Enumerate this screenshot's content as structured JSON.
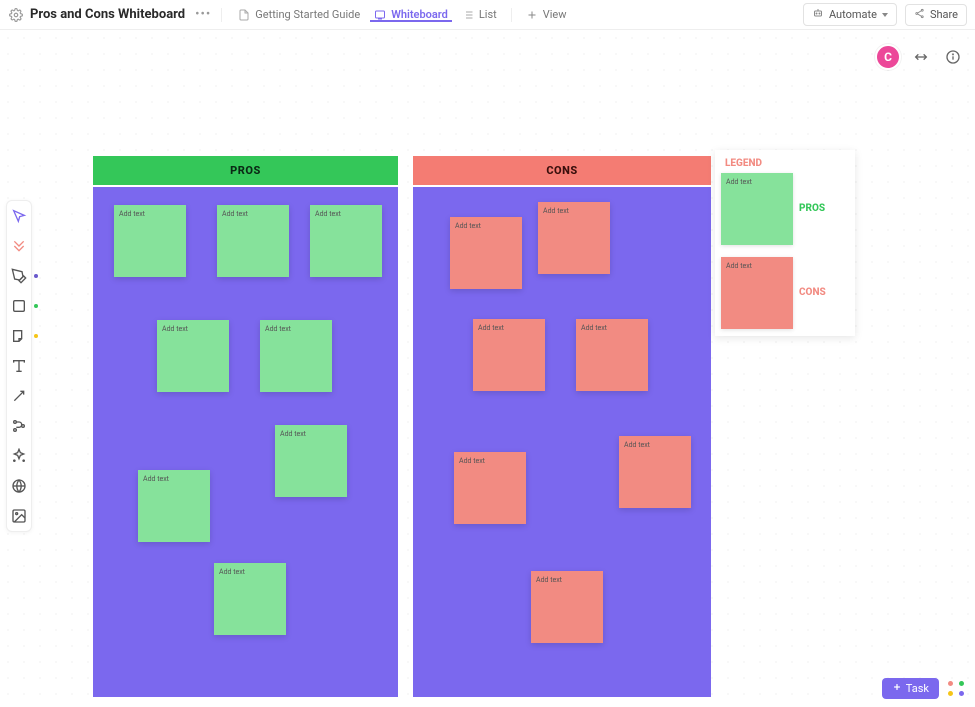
{
  "header": {
    "title": "Pros and Cons Whiteboard",
    "tabs": {
      "guide": "Getting Started Guide",
      "whiteboard": "Whiteboard",
      "list": "List",
      "view": "View"
    },
    "automate": "Automate",
    "share": "Share"
  },
  "avatar_initial": "C",
  "columns": {
    "pros": {
      "label": "PROS",
      "header_color": "#34c759",
      "body_color": "#7b68ee"
    },
    "cons": {
      "label": "CONS",
      "header_color": "#f47c73",
      "body_color": "#7b68ee"
    }
  },
  "note_placeholder": "Add text",
  "legend": {
    "title": "LEGEND",
    "pros_label": "PROS",
    "cons_label": "CONS",
    "pros_color": "#34c759",
    "cons_color": "#f28b82"
  },
  "task_button": "Task",
  "colors": {
    "accent": "#7b68ee",
    "note_green": "#86e29b",
    "note_red": "#f28b82",
    "avatar": "#ec4899"
  },
  "tool_dot_colors": {
    "pen": "#6a5acd",
    "shape": "#34c759",
    "sticky": "#f5c518"
  }
}
